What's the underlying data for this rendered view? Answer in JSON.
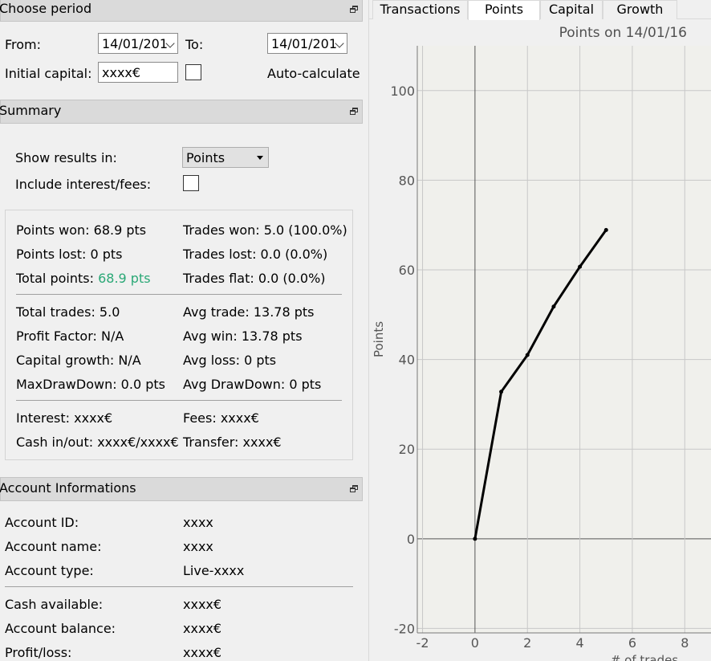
{
  "period": {
    "title": "Choose period",
    "from_label": "From:",
    "from_value": "14/01/201",
    "to_label": "To:",
    "to_value": "14/01/201",
    "capital_label": "Initial capital:",
    "capital_value": "xxxx€",
    "auto_label": "Auto-calculate"
  },
  "summary": {
    "title": "Summary",
    "show_label": "Show results in:",
    "show_value": "Points",
    "include_label": "Include interest/fees:",
    "stats": {
      "points_won": "Points won: 68.9 pts",
      "points_lost": "Points lost: 0 pts",
      "total_points_label": "Total points: ",
      "total_points_value": "68.9 pts",
      "trades_won": "Trades won: 5.0 (100.0%)",
      "trades_lost": "Trades lost: 0.0 (0.0%)",
      "trades_flat": "Trades flat: 0.0 (0.0%)",
      "total_trades": "Total trades: 5.0",
      "profit_factor": "Profit Factor: N/A",
      "capital_growth": "Capital growth: N/A",
      "max_drawdown": "MaxDrawDown: 0.0 pts",
      "avg_trade": "Avg trade: 13.78 pts",
      "avg_win": "Avg win: 13.78 pts",
      "avg_loss": "Avg loss: 0 pts",
      "avg_drawdown": "Avg DrawDown: 0 pts",
      "interest": "Interest: xxxx€",
      "cash_inout": "Cash in/out: xxxx€/xxxx€",
      "fees": "Fees: xxxx€",
      "transfer": "Transfer: xxxx€"
    },
    "accent_color": "#2aa876"
  },
  "account": {
    "title": "Account Informations",
    "rows": [
      {
        "label": "Account ID:",
        "value": "xxxx"
      },
      {
        "label": "Account name:",
        "value": "xxxx"
      },
      {
        "label": "Account type:",
        "value": "Live-xxxx"
      },
      {
        "label": "Cash available:",
        "value": "xxxx€"
      },
      {
        "label": "Account balance:",
        "value": "xxxx€"
      },
      {
        "label": "Profit/loss:",
        "value": "xxxx€"
      }
    ]
  },
  "tabs": [
    {
      "label": "Transactions",
      "active": false
    },
    {
      "label": "Points",
      "active": true
    },
    {
      "label": "Capital",
      "active": false
    },
    {
      "label": "Growth",
      "active": false
    }
  ],
  "chart_data": {
    "type": "line",
    "title": "Points on 14/01/16",
    "xlabel": "# of trades",
    "ylabel": "Points",
    "x": [
      0,
      1,
      2,
      3,
      4,
      5
    ],
    "y": [
      0,
      32.8,
      41.0,
      51.8,
      60.7,
      68.9
    ],
    "xlim": [
      -2.2,
      9
    ],
    "ylim": [
      -21,
      110
    ],
    "xticks": [
      -2,
      0,
      2,
      4,
      6,
      8
    ],
    "yticks": [
      -20,
      0,
      20,
      40,
      60,
      80,
      100
    ],
    "grid": true,
    "line_color": "#000000"
  }
}
